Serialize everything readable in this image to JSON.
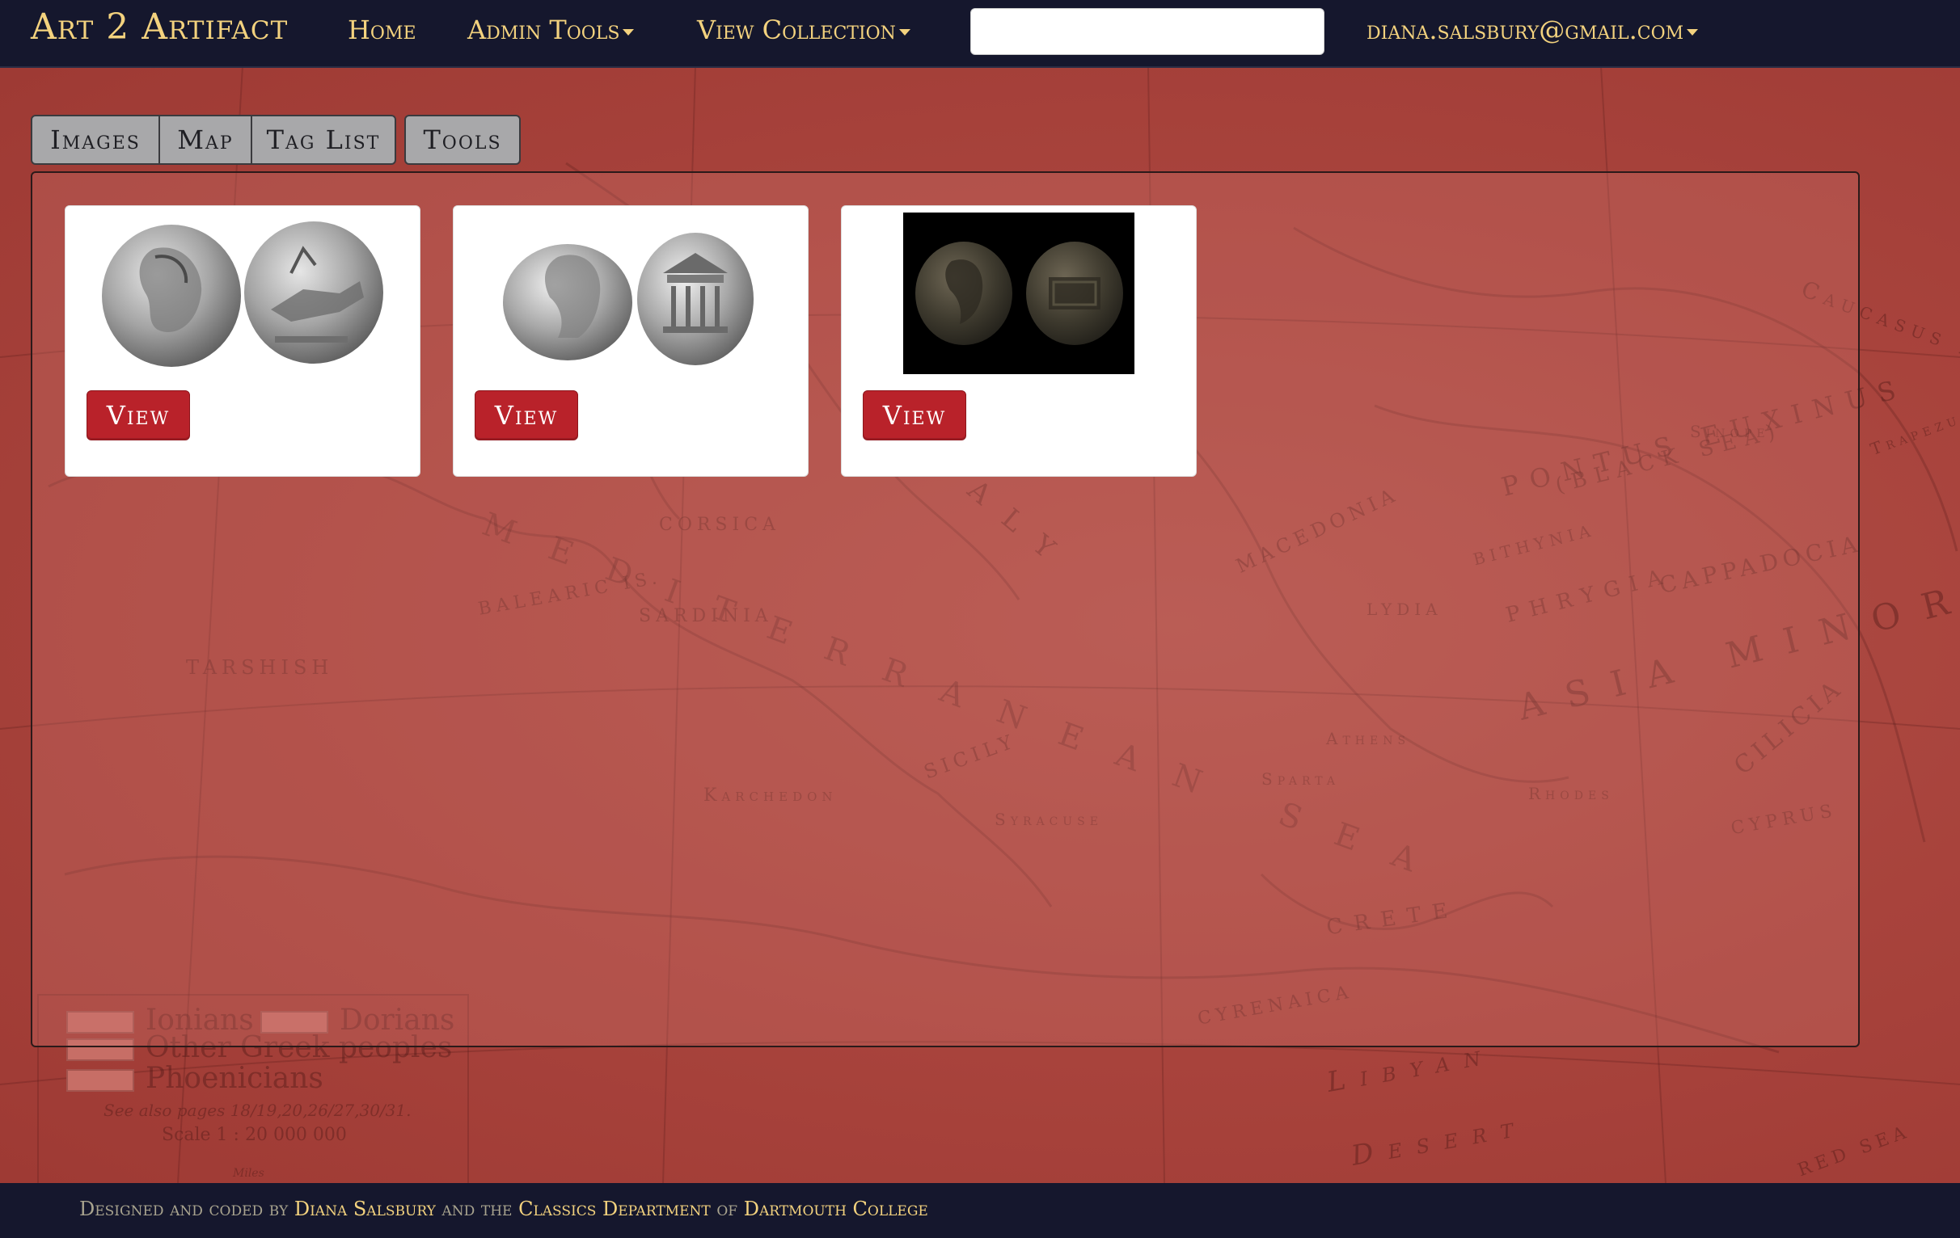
{
  "navbar": {
    "brand": "Art 2 Artifact",
    "items": [
      {
        "label": "Home"
      },
      {
        "label": "Admin Tools"
      },
      {
        "label": "View Collection"
      }
    ],
    "search": {
      "value": "",
      "placeholder": ""
    },
    "user": "diana.salsbury@gmail.com"
  },
  "tabs": [
    {
      "label": "Images"
    },
    {
      "label": "Map"
    },
    {
      "label": "Tag List"
    },
    {
      "label": "Tools"
    }
  ],
  "cards": [
    {
      "image": "silver-denarius-head-and-chariot",
      "button": "View"
    },
    {
      "image": "silver-denarius-head-and-temple",
      "button": "View"
    },
    {
      "image": "bronze-coin-head-and-altar-dark-background",
      "button": "View"
    }
  ],
  "background_map": {
    "labels": [
      "Ionians",
      "Dorians",
      "Other Greek peoples",
      "Phoenicians",
      "See also pages 18/19,20,26/27,30/31.",
      "Scale 1 : 20 000 000",
      "Miles",
      "CORSICA",
      "SARDINIA",
      "BALEARIC IS.",
      "TARSHISH",
      "MACEDONIA",
      "CAPPADOCIA",
      "ASIA MINOR",
      "CILICIA",
      "PONTUS EUXINUS",
      "(BLACK SEA)",
      "CRETE",
      "CYRENAICA",
      "Libyan",
      "Desert",
      "CYPRUS",
      "RED SEA",
      "ITALY",
      "SICILY",
      "MEDITERRANEAN SEA",
      "Caucasus Mts.",
      "LYDIA",
      "PHRYGIA",
      "BITHYNIA",
      "Sinope",
      "Trapezus",
      "Rhodes",
      "Sparta",
      "Athens",
      "Syracuse",
      "Karchedon"
    ],
    "swatch_color": "#c76e66"
  },
  "footer": {
    "prefix": "Designed and coded by ",
    "author": "Diana Salsbury",
    "mid1": " and the ",
    "dept": "Classics Department",
    "mid2": " of ",
    "college": "Dartmouth College"
  },
  "colors": {
    "navbar_bg": "#15172d",
    "nav_text": "#f3d27e",
    "page_bg": "#a8403a",
    "button": "#b9222a",
    "tab_bg": "#a8a8aa"
  }
}
